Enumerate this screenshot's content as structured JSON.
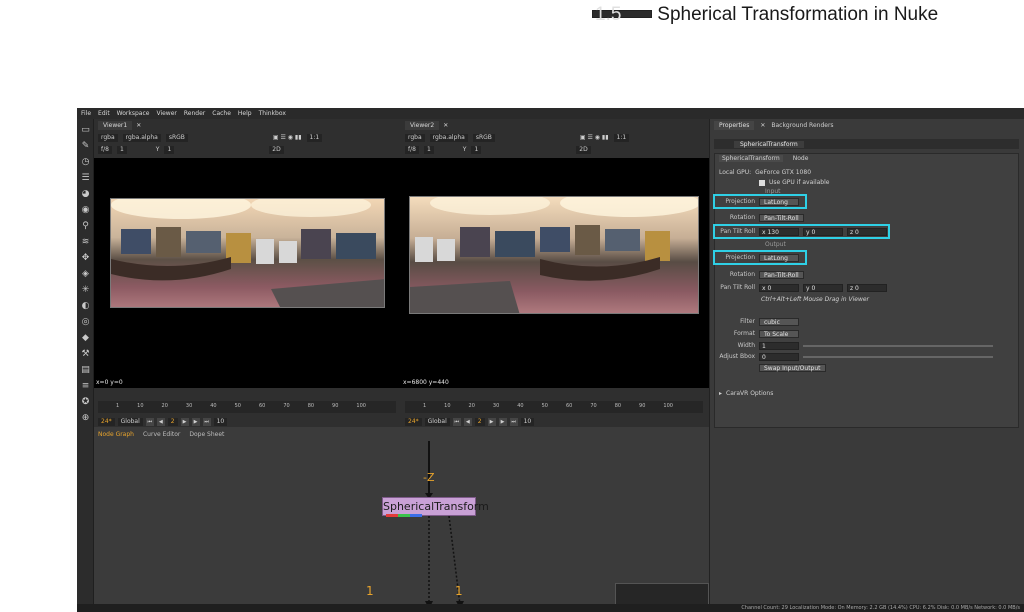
{
  "document": {
    "section_number": "1.5",
    "section_title": "Spherical Transformation in Nuke"
  },
  "menubar": {
    "items": [
      "File",
      "Edit",
      "Workspace",
      "Viewer",
      "Render",
      "Cache",
      "Help",
      "Thinkbox"
    ]
  },
  "viewer1": {
    "tab": "Viewer1",
    "channels": "rgba",
    "alpha": "rgba.alpha",
    "colorspace": "sRGB",
    "zoom": "1:1",
    "frame_fields": [
      "f/8",
      "1"
    ],
    "y_label": "Y",
    "y_value": "1",
    "mode": "2D",
    "coords": "x=0 y=0"
  },
  "viewer2": {
    "tab": "Viewer2",
    "channels": "rgba",
    "alpha": "rgba.alpha",
    "colorspace": "sRGB",
    "zoom": "1:1",
    "frame_fields": [
      "f/8",
      "1"
    ],
    "y_label": "Y",
    "y_value": "1",
    "mode": "2D",
    "coords": "x=6800 y=440"
  },
  "timeline": {
    "ticks": [
      "1",
      "10",
      "20",
      "30",
      "40",
      "50",
      "60",
      "70",
      "80",
      "90",
      "100"
    ],
    "start": "1",
    "end": "100",
    "fps": "24*",
    "scope": "Global",
    "current_frame": "2",
    "step": "10"
  },
  "nodegraph": {
    "tabs": [
      "Node Graph",
      "Curve Editor",
      "Dope Sheet"
    ],
    "node_label": "SphericalTransform",
    "axis_label": "-Z",
    "input_labels": [
      "1",
      "1"
    ]
  },
  "properties": {
    "tabs": [
      "Properties",
      "Background Renders"
    ],
    "node_name": "SphericalTransform",
    "node_tabs": [
      "SphericalTransform",
      "Node"
    ],
    "local_gpu_label": "Local GPU:",
    "local_gpu_value": "GeForce GTX 1080",
    "use_gpu_label": "Use GPU if available",
    "input_section": "Input",
    "output_section": "Output",
    "input_projection_label": "Projection",
    "input_projection_value": "LatLong",
    "input_rotation_label": "Rotation",
    "input_rotation_value": "Pan-Tilt-Roll",
    "input_ptr_label": "Pan Tilt Roll",
    "input_ptr_x": "x 130",
    "input_ptr_y": "y 0",
    "input_ptr_z": "z 0",
    "output_projection_label": "Projection",
    "output_projection_value": "LatLong",
    "output_rotation_label": "Rotation",
    "output_rotation_value": "Pan-Tilt-Roll",
    "output_ptr_label": "Pan Tilt Roll",
    "output_ptr_x": "x 0",
    "output_ptr_y": "y 0",
    "output_ptr_z": "z 0",
    "hint": "Ctrl+Alt+Left Mouse Drag in Viewer",
    "filter_label": "Filter",
    "filter_value": "cubic",
    "format_label": "Format",
    "format_value": "To Scale",
    "width_label": "Width",
    "width_value": "1",
    "adjust_label": "Adjust Bbox",
    "adjust_value": "0",
    "swap_button": "Swap Input/Output",
    "cara_label": "CaraVR Options"
  },
  "status": {
    "text": "Channel Count: 29 Localization Mode: On Memory: 2.2 GB (14.4%) CPU: 6.2% Disk: 0.0 MB/s Network: 0.0 MB/s"
  },
  "colors": {
    "highlight": "#2fd0e6",
    "node": "#c9a1d6",
    "accent": "#e8a42c"
  }
}
